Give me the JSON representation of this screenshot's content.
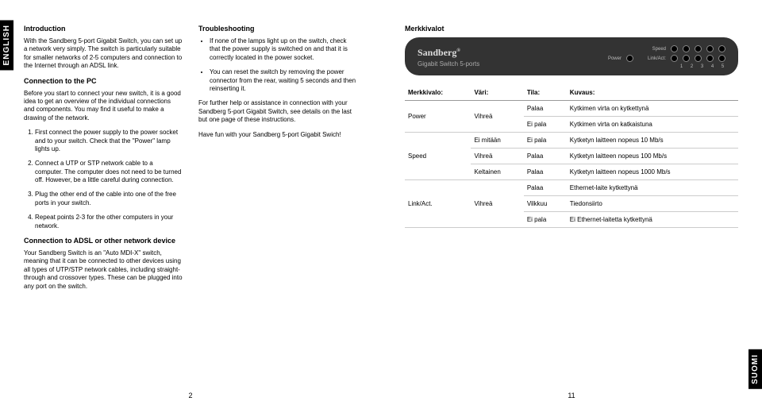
{
  "sideTabs": {
    "english": "ENGLISH",
    "suomi": "SUOMI"
  },
  "pageNumbers": {
    "left": "2",
    "right": "11"
  },
  "left": {
    "col1": {
      "h1": "Introduction",
      "p1": "With the Sandberg 5-port Gigabit Switch, you can set up a network very simply. The switch is particularly suitable for smaller networks of 2-5 computers and connection to the Internet through an ADSL link.",
      "h2": "Connection to the PC",
      "p2": "Before you start to connect your new switch, it is a good idea to get an overview of the individual connections and components. You may find it useful to make a drawing of the network.",
      "li1": "First connect the power supply to the power socket and to your switch. Check that the \"Power\" lamp lights up.",
      "li2": "Connect a UTP or STP network cable to a computer. The computer does not need to be turned off. However, be a little careful during connection.",
      "li3": "Plug the other end of the cable into one of the free ports in your switch.",
      "li4": "Repeat points 2-3 for the other computers in your network.",
      "h3": "Connection to ADSL or other network device",
      "p3": "Your Sandberg Switch is an \"Auto MDI-X\" switch, meaning that it can be connected to other devices using all types of UTP/STP network cables, including straight-through and crossover types. These can be plugged into any port on the switch."
    },
    "col2": {
      "h1": "Troubleshooting",
      "li1": "If none of the lamps light up on the switch, check that the power supply is switched on and that it is correctly located in the power socket.",
      "li2": "You can reset the switch by removing the power connector from the rear, waiting 5 seconds and then reinserting it.",
      "p1": "For further help or assistance in connection with your Sandberg 5-port Gigabit Switch, see details on the last but one page of these instructions.",
      "p2": "Have fun with your Sandberg 5-port Gigabit Swich!"
    }
  },
  "right": {
    "h1": "Merkkivalot",
    "device": {
      "brand": "Sandberg",
      "reg": "®",
      "model": "Gigabit Switch 5-ports",
      "speedLabel": "Speed",
      "powerLabel": "Power",
      "linkActLabel": "Link/Act:",
      "portNumbers": [
        "1",
        "2",
        "3",
        "4",
        "5"
      ]
    },
    "table": {
      "headers": [
        "Merkkivalo:",
        "Väri:",
        "Tila:",
        "Kuvaus:"
      ],
      "rows": [
        {
          "c0": "Power",
          "c1": "Vihreä",
          "c2": "Palaa",
          "c3": "Kytkimen virta on kytkettynä",
          "rowspan0": 2,
          "rowspan1": 2
        },
        {
          "c2": "Ei pala",
          "c3": "Kytkimen virta on katkaistuna"
        },
        {
          "c0": "Speed",
          "c1": "Ei mitään",
          "c2": "Ei pala",
          "c3": "Kytketyn laitteen nopeus 10 Mb/s",
          "rowspan0": 3
        },
        {
          "c1": "Vihreä",
          "c2": "Palaa",
          "c3": "Kytketyn laitteen nopeus 100 Mb/s"
        },
        {
          "c1": "Keltainen",
          "c2": "Palaa",
          "c3": "Kytketyn laitteen nopeus 1000 Mb/s"
        },
        {
          "c0": "Link/Act.",
          "c1": "Vihreä",
          "c2": "Palaa",
          "c3": "Ethernet-laite kytkettynä",
          "rowspan0": 3,
          "rowspan1": 3
        },
        {
          "c2": "Vilkkuu",
          "c3": "Tiedonsiirto"
        },
        {
          "c2": "Ei pala",
          "c3": "Ei Ethernet-laitetta kytkettynä"
        }
      ]
    }
  }
}
